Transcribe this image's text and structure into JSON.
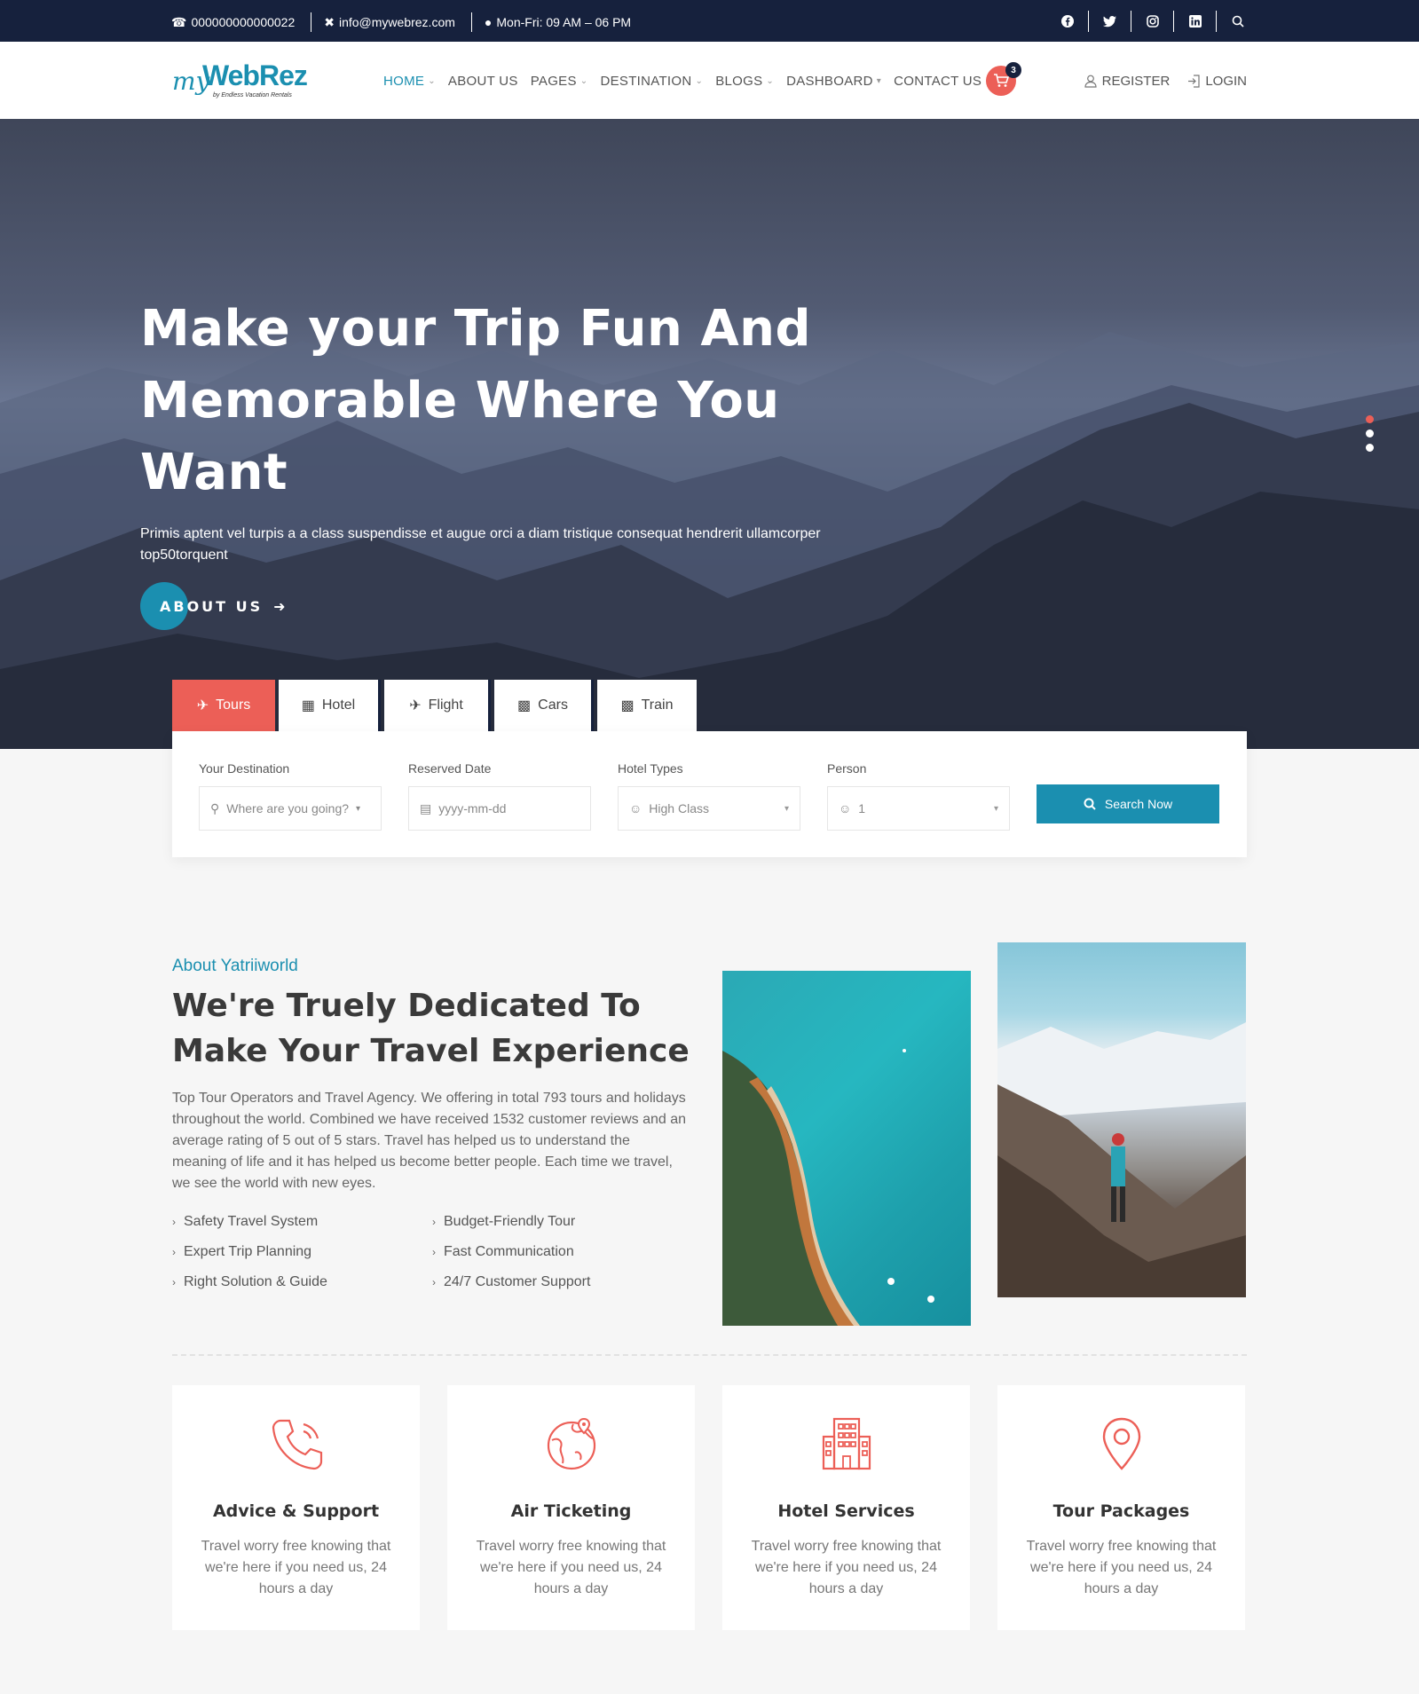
{
  "topbar": {
    "phone": "000000000000022",
    "email": "info@mywebrez.com",
    "hours": "Mon-Fri: 09 AM – 06 PM"
  },
  "brand": {
    "logo_my": "my",
    "logo_web": "WebRez",
    "logo_sub": "by Endless Vacation Rentals"
  },
  "nav": {
    "items": [
      "HOME",
      "ABOUT US",
      "PAGES",
      "DESTINATION",
      "BLOGS",
      "DASHBOARD",
      "CONTACT US"
    ],
    "cart_count": "3",
    "register": "REGISTER",
    "login": "LOGIN"
  },
  "hero": {
    "title": "Make your Trip Fun And Memorable Where You Want",
    "subtitle": "Primis aptent vel turpis a a class suspendisse et augue orci a diam tristique consequat hendrerit ullamcorper top50torquent",
    "cta": "ABOUT US"
  },
  "booking": {
    "tabs": [
      "Tours",
      "Hotel",
      "Flight",
      "Cars",
      "Train"
    ],
    "destination_label": "Your Destination",
    "destination_placeholder": "Where are you going?",
    "date_label": "Reserved Date",
    "date_placeholder": "yyyy-mm-dd",
    "hotel_label": "Hotel Types",
    "hotel_value": "High Class",
    "person_label": "Person",
    "person_value": "1",
    "search_button": "Search Now"
  },
  "about": {
    "kicker": "About Yatriiworld",
    "title": "We're Truely Dedicated To Make Your Travel Experience",
    "text": "Top Tour Operators and Travel Agency. We offering in total 793 tours and holidays throughout the world. Combined we have received 1532 customer reviews and an average rating of 5 out of 5 stars. Travel has helped us to understand the meaning of life and it has helped us become better people. Each time we travel, we see the world with new eyes.",
    "features": [
      "Safety Travel System",
      "Budget-Friendly Tour",
      "Expert Trip Planning",
      "Fast Communication",
      "Right Solution & Guide",
      "24/7 Customer Support"
    ]
  },
  "services": [
    {
      "title": "Advice & Support",
      "text": "Travel worry free knowing that we're here if you need us, 24 hours a day",
      "icon": "phone-icon"
    },
    {
      "title": "Air Ticketing",
      "text": "Travel worry free knowing that we're here if you need us, 24 hours a day",
      "icon": "globe-icon"
    },
    {
      "title": "Hotel Services",
      "text": "Travel worry free knowing that we're here if you need us, 24 hours a day",
      "icon": "hotel-icon"
    },
    {
      "title": "Tour Packages",
      "text": "Travel worry free knowing that we're here if you need us, 24 hours a day",
      "icon": "map-pin-icon"
    }
  ],
  "colors": {
    "topbar": "#16213d",
    "accent": "#1b8fb0",
    "highlight": "#ec5f57"
  }
}
